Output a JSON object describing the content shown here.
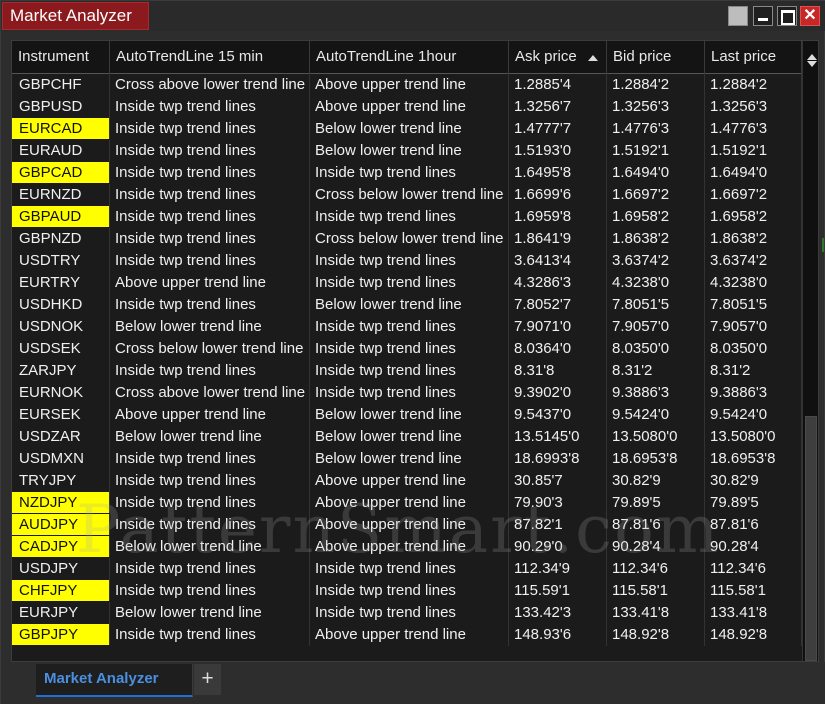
{
  "window": {
    "title": "Market Analyzer",
    "close_glyph": "✕",
    "icons": [
      "minimize-icon",
      "maximize-icon",
      "close-icon"
    ]
  },
  "columns": [
    "Instrument",
    "AutoTrendLine 15 min",
    "AutoTrendLine 1hour",
    "Ask price",
    "Bid price",
    "Last price"
  ],
  "sort": {
    "column": "Ask price",
    "direction": "ascending"
  },
  "highlight_color": "#ffff00",
  "rows": [
    [
      "GBPCHF",
      "Cross above lower trend line",
      "Above upper trend line",
      "1.2885'4",
      "1.2884'2",
      "1.2884'2",
      false
    ],
    [
      "GBPUSD",
      "Inside twp trend lines",
      "Above upper trend line",
      "1.3256'7",
      "1.3256'3",
      "1.3256'3",
      false
    ],
    [
      "EURCAD",
      "Inside twp trend lines",
      "Below lower trend line",
      "1.4777'7",
      "1.4776'3",
      "1.4776'3",
      true
    ],
    [
      "EURAUD",
      "Inside twp trend lines",
      "Below lower trend line",
      "1.5193'0",
      "1.5192'1",
      "1.5192'1",
      false
    ],
    [
      "GBPCAD",
      "Inside twp trend lines",
      "Inside twp trend lines",
      "1.6495'8",
      "1.6494'0",
      "1.6494'0",
      true
    ],
    [
      "EURNZD",
      "Inside twp trend lines",
      "Cross below lower trend line",
      "1.6699'6",
      "1.6697'2",
      "1.6697'2",
      false
    ],
    [
      "GBPAUD",
      "Inside twp trend lines",
      "Inside twp trend lines",
      "1.6959'8",
      "1.6958'2",
      "1.6958'2",
      true
    ],
    [
      "GBPNZD",
      "Inside twp trend lines",
      "Cross below lower trend line",
      "1.8641'9",
      "1.8638'2",
      "1.8638'2",
      false
    ],
    [
      "USDTRY",
      "Inside twp trend lines",
      "Inside twp trend lines",
      "3.6413'4",
      "3.6374'2",
      "3.6374'2",
      false
    ],
    [
      "EURTRY",
      "Above upper trend line",
      "Inside twp trend lines",
      "4.3286'3",
      "4.3238'0",
      "4.3238'0",
      false
    ],
    [
      "USDHKD",
      "Inside twp trend lines",
      "Below lower trend line",
      "7.8052'7",
      "7.8051'5",
      "7.8051'5",
      false
    ],
    [
      "USDNOK",
      "Below lower trend line",
      "Inside twp trend lines",
      "7.9071'0",
      "7.9057'0",
      "7.9057'0",
      false
    ],
    [
      "USDSEK",
      "Cross below lower trend line",
      "Inside twp trend lines",
      "8.0364'0",
      "8.0350'0",
      "8.0350'0",
      false
    ],
    [
      "ZARJPY",
      "Inside twp trend lines",
      "Inside twp trend lines",
      "8.31'8",
      "8.31'2",
      "8.31'2",
      false
    ],
    [
      "EURNOK",
      "Cross above lower trend line",
      "Inside twp trend lines",
      "9.3902'0",
      "9.3886'3",
      "9.3886'3",
      false
    ],
    [
      "EURSEK",
      "Above upper trend line",
      "Below lower trend line",
      "9.5437'0",
      "9.5424'0",
      "9.5424'0",
      false
    ],
    [
      "USDZAR",
      "Below lower trend line",
      "Below lower trend line",
      "13.5145'0",
      "13.5080'0",
      "13.5080'0",
      false
    ],
    [
      "USDMXN",
      "Inside twp trend lines",
      "Below lower trend line",
      "18.6993'8",
      "18.6953'8",
      "18.6953'8",
      false
    ],
    [
      "TRYJPY",
      "Inside twp trend lines",
      "Above upper trend line",
      "30.85'7",
      "30.82'9",
      "30.82'9",
      false
    ],
    [
      "NZDJPY",
      "Inside twp trend lines",
      "Above upper trend line",
      "79.90'3",
      "79.89'5",
      "79.89'5",
      true
    ],
    [
      "AUDJPY",
      "Inside twp trend lines",
      "Above upper trend line",
      "87.82'1",
      "87.81'6",
      "87.81'6",
      true
    ],
    [
      "CADJPY",
      "Below lower trend line",
      "Above upper trend line",
      "90.29'0",
      "90.28'4",
      "90.28'4",
      true
    ],
    [
      "USDJPY",
      "Inside twp trend lines",
      "Inside twp trend lines",
      "112.34'9",
      "112.34'6",
      "112.34'6",
      false
    ],
    [
      "CHFJPY",
      "Inside twp trend lines",
      "Inside twp trend lines",
      "115.59'1",
      "115.58'1",
      "115.58'1",
      true
    ],
    [
      "EURJPY",
      "Below lower trend line",
      "Inside twp trend lines",
      "133.42'3",
      "133.41'8",
      "133.41'8",
      false
    ],
    [
      "GBPJPY",
      "Inside twp trend lines",
      "Above upper trend line",
      "148.93'6",
      "148.92'8",
      "148.92'8",
      true
    ]
  ],
  "watermark": "PatternSmart.com",
  "tabs": {
    "active": "Market Analyzer",
    "add_glyph": "+"
  }
}
